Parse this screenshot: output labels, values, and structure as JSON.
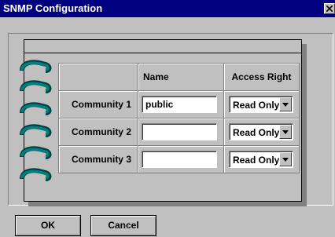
{
  "window": {
    "title": "SNMP Configuration"
  },
  "table": {
    "headers": [
      "",
      "Name",
      "Access Right"
    ],
    "rows": [
      {
        "label": "Community 1",
        "name": "public",
        "access": "Read Only"
      },
      {
        "label": "Community 2",
        "name": "",
        "access": "Read Only"
      },
      {
        "label": "Community 3",
        "name": "",
        "access": "Read Only"
      }
    ]
  },
  "buttons": {
    "ok": "OK",
    "cancel": "Cancel"
  },
  "icons": {
    "close": "close-icon",
    "dropdown": "chevron-down-icon",
    "rings": "binder-ring-icon"
  },
  "colors": {
    "titlebar": "#000080",
    "face": "#c0c0c0",
    "ring": "#008080"
  }
}
